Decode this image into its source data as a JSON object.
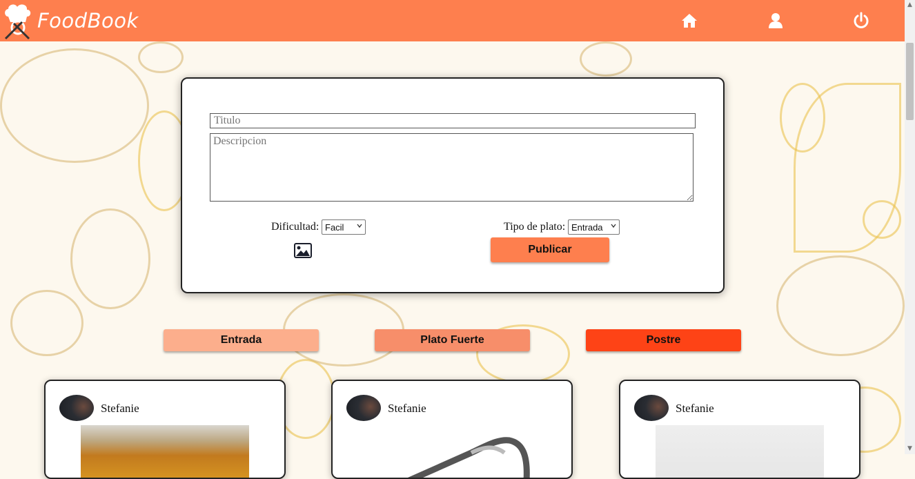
{
  "app": {
    "name": "FoodBook",
    "brand_color": "#fe7f4e"
  },
  "navbar": {
    "icons": [
      "home-icon",
      "user-icon",
      "power-icon"
    ]
  },
  "post_form": {
    "title_placeholder": "Titulo",
    "description_placeholder": "Descripcion",
    "difficulty_label": "Dificultad:",
    "difficulty_value": "Facil",
    "dish_type_label": "Tipo de plato:",
    "dish_type_value": "Entrada",
    "image_icon": "image-icon",
    "publish_label": "Publicar"
  },
  "filters": [
    {
      "label": "Entrada",
      "color": "#fcae8c"
    },
    {
      "label": "Plato Fuerte",
      "color": "#f78e6a"
    },
    {
      "label": "Postre",
      "color": "#fe4316"
    }
  ],
  "posts": [
    {
      "author": "Stefanie"
    },
    {
      "author": "Stefanie"
    },
    {
      "author": "Stefanie"
    }
  ]
}
